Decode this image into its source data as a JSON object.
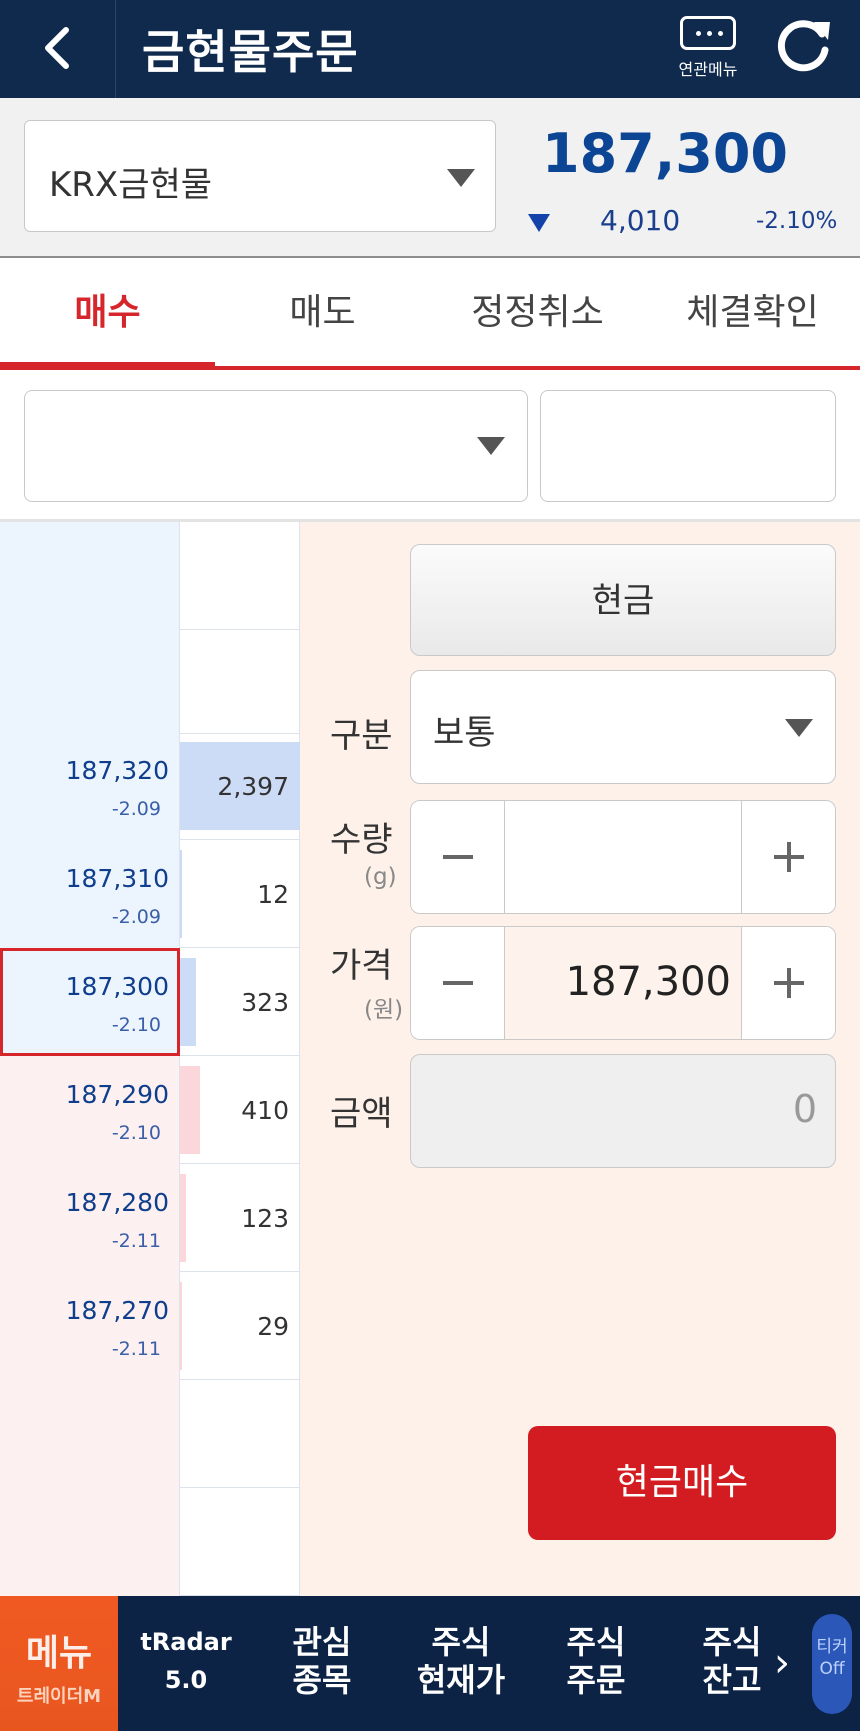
{
  "header": {
    "title": "금현물주문",
    "related_menu_label": "연관메뉴"
  },
  "stock": {
    "name": "KRX금현물",
    "price": "187,300",
    "change": "4,010",
    "change_pct": "-2.10%"
  },
  "tabs": [
    {
      "label": "매수",
      "active": true
    },
    {
      "label": "매도",
      "active": false
    },
    {
      "label": "정정취소",
      "active": false
    },
    {
      "label": "체결확인",
      "active": false
    }
  ],
  "filter": {
    "account_select_value": "",
    "password_input_value": ""
  },
  "orderbook": {
    "rows": [
      {
        "price": "",
        "pct": "",
        "qty": "",
        "side": "ask",
        "bar_fraction": 0
      },
      {
        "price": "",
        "pct": "",
        "qty": "",
        "side": "ask",
        "bar_fraction": 0
      },
      {
        "price": "187,320",
        "pct": "-2.09",
        "qty": "2,397",
        "side": "ask",
        "bar_fraction": 1.0
      },
      {
        "price": "187,310",
        "pct": "-2.09",
        "qty": "12",
        "side": "ask",
        "bar_fraction": 0.005
      },
      {
        "price": "187,300",
        "pct": "-2.10",
        "qty": "323",
        "side": "ask",
        "bar_fraction": 0.13,
        "selected": true
      },
      {
        "price": "187,290",
        "pct": "-2.10",
        "qty": "410",
        "side": "bid",
        "bar_fraction": 0.17
      },
      {
        "price": "187,280",
        "pct": "-2.11",
        "qty": "123",
        "side": "bid",
        "bar_fraction": 0.05
      },
      {
        "price": "187,270",
        "pct": "-2.11",
        "qty": "29",
        "side": "bid",
        "bar_fraction": 0.01
      },
      {
        "price": "",
        "pct": "",
        "qty": "",
        "side": "bid",
        "bar_fraction": 0
      },
      {
        "price": "",
        "pct": "",
        "qty": "",
        "side": "bid",
        "bar_fraction": 0
      }
    ]
  },
  "order": {
    "cash_label": "현금",
    "type_label": "구분",
    "type_value": "보통",
    "qty_label": "수량",
    "qty_unit": "(g)",
    "qty_value": "",
    "price_label": "가격",
    "price_unit": "(원)",
    "price_value": "187,300",
    "amount_label": "금액",
    "amount_value": "0",
    "submit_label": "현금매수"
  },
  "bottom_nav": {
    "menu_label": "메뉴",
    "menu_sub": "트레이더M",
    "items": [
      {
        "l1": "tRadar",
        "l2": "5.0"
      },
      {
        "l1": "관심",
        "l2": "종목"
      },
      {
        "l1": "주식",
        "l2": "현재가"
      },
      {
        "l1": "주식",
        "l2": "주문"
      },
      {
        "l1": "주식",
        "l2": "잔고"
      }
    ],
    "ticker_l1": "티커",
    "ticker_l2": "Off"
  },
  "colors": {
    "header_bg": "#0f2a4d",
    "accent_red": "#d6262b",
    "price_blue": "#0d4595",
    "ask_bg": "#ecf4fe",
    "bid_bg": "#fdf0f0",
    "ask_bar": "#cddcf6",
    "bid_bar": "#fbd6da",
    "order_panel_bg": "#fdf1ea"
  },
  "icons": {
    "back": "chevron-left-icon",
    "related_menu": "more-dots-icon",
    "refresh": "refresh-icon",
    "dropdown": "triangle-down-icon",
    "minus": "minus-icon",
    "plus": "plus-icon",
    "next": "chevron-right-icon"
  }
}
